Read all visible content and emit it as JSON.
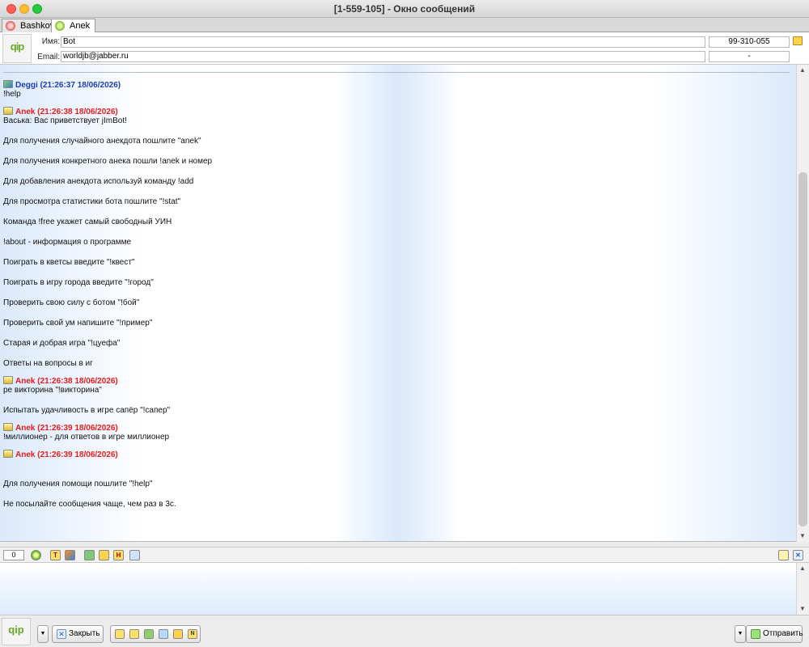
{
  "window": {
    "title": "[1-559-105] - Окно сообщений"
  },
  "tabs": [
    {
      "label": "Bashkov",
      "icon": "flower-icon",
      "active": false
    },
    {
      "label": "Anek",
      "icon": "smile-icon",
      "active": true
    }
  ],
  "contact": {
    "name_label": "Имя:",
    "name_value": "Bot",
    "email_label": "Email:",
    "email_value": "worldjb@jabber.ru",
    "uin": "99-310-055",
    "status": "-",
    "logo_text": "qip"
  },
  "messages": [
    {
      "sender": "Deggi",
      "time": "(21:26:37 18/06/2026)",
      "direction": "incoming",
      "lines": [
        "!help"
      ]
    },
    {
      "sender": "Anek",
      "time": "(21:26:38 18/06/2026)",
      "direction": "outgoing",
      "lines": [
        "Васька: Вас приветствует jImBot!",
        "Для получения случайного анекдота пошлите \"anek\"",
        "Для получения конкретного анека пошли !anek и номер",
        "Для добавления анекдота используй команду !add",
        "Для просмотра статистики бота пошлите \"!stat\"",
        "Команда !free укажет самый свободный УИН",
        "!about - информация о программе",
        "Поиграть в кветсы введите \"!квест\"",
        "Поиграть в игру города введите \"!город\"",
        "Проверить свою силу с ботом \"!бой\"",
        "Проверить свой ум напишите \"!пример\"",
        "Старая и добрая игра  \"!цуефа\"",
        "Ответы на вопросы в иг"
      ]
    },
    {
      "sender": "Anek",
      "time": "(21:26:38 18/06/2026)",
      "direction": "outgoing",
      "lines": [
        "ре викторина  \"!викторина\"",
        "Испытать удачливость в игре сапёр \"!сапер\""
      ]
    },
    {
      "sender": "Anek",
      "time": "(21:26:39 18/06/2026)",
      "direction": "outgoing",
      "lines": [
        "!миллионер - для ответов в игре миллионер"
      ]
    },
    {
      "sender": "Anek",
      "time": "(21:26:39 18/06/2026)",
      "direction": "outgoing",
      "lines": [
        "",
        "Для получения помощи пошлите \"!help\"",
        "Не посылайте сообщения чаще,  чем раз в 3с."
      ]
    }
  ],
  "toolbar": {
    "char_count": "0",
    "icons": [
      "smile-icon",
      "text-format-icon",
      "color-icon",
      "save-icon",
      "folder-icon",
      "history-icon",
      "search-icon",
      "note-icon",
      "close-icon"
    ]
  },
  "bottom": {
    "close_label": "Закрыть",
    "send_label": "Отправить",
    "logo_text": "qip"
  },
  "colors": {
    "incoming": "#1b3fae",
    "outgoing": "#e51c1c"
  }
}
